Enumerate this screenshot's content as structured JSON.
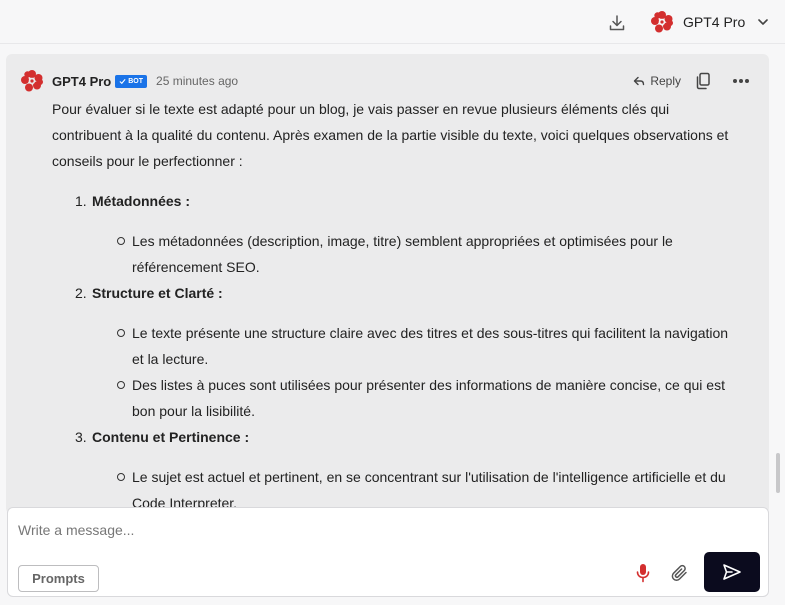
{
  "topbar": {
    "download_icon": "download-icon",
    "model_name": "GPT4 Pro"
  },
  "message": {
    "author": "GPT4 Pro",
    "badge": "BOT",
    "time": "25 minutes ago",
    "reply_label": "Reply",
    "intro": "Pour évaluer si le texte est adapté pour un blog, je vais passer en revue plusieurs éléments clés qui contribuent à la qualité du contenu. Après examen de la partie visible du texte, voici quelques observations et conseils pour le perfectionner :",
    "sections": [
      {
        "number": "1.",
        "title": "Métadonnées :",
        "bullets": [
          "Les métadonnées (description, image, titre) semblent appropriées et optimisées pour le référencement SEO."
        ]
      },
      {
        "number": "2.",
        "title": "Structure et Clarté :",
        "bullets": [
          "Le texte présente une structure claire avec des titres et des sous-titres qui facilitent la navigation et la lecture.",
          "Des listes à puces sont utilisées pour présenter des informations de manière concise, ce qui est bon pour la lisibilité."
        ]
      },
      {
        "number": "3.",
        "title": "Contenu et Pertinence :",
        "bullets": [
          "Le sujet est actuel et pertinent, en se concentrant sur l'utilisation de l'intelligence artificielle et du Code Interpreter."
        ]
      }
    ]
  },
  "composer": {
    "placeholder": "Write a message...",
    "prompts_label": "Prompts"
  },
  "colors": {
    "brand_red": "#d32f2f",
    "badge_blue": "#1a73e8",
    "send_bg": "#0b0b1e",
    "mic_red": "#d32f2f"
  }
}
